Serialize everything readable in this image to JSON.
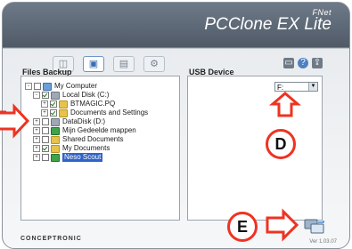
{
  "app": {
    "brand_top": "FNet",
    "brand_main": "PCClone EX Lite"
  },
  "tabs": [
    {
      "name": "tab-1",
      "icon": "drive-icon"
    },
    {
      "name": "tab-2",
      "icon": "monitor-icon"
    },
    {
      "name": "tab-3",
      "icon": "image-icon"
    },
    {
      "name": "tab-4",
      "icon": "settings-icon"
    }
  ],
  "utility": [
    {
      "icon": "screen-icon"
    },
    {
      "icon": "help-icon"
    },
    {
      "icon": "upload-icon"
    }
  ],
  "files_backup": {
    "label": "Files Backup",
    "tree": [
      {
        "level": 0,
        "exp": "-",
        "checked": false,
        "icon": "pc",
        "text": "My Computer"
      },
      {
        "level": 1,
        "exp": "-",
        "checked": true,
        "icon": "drive",
        "text": "Local Disk (C:)"
      },
      {
        "level": 2,
        "exp": "+",
        "checked": true,
        "icon": "folder",
        "text": "BTMAGIC.PQ"
      },
      {
        "level": 2,
        "exp": "+",
        "checked": true,
        "icon": "folder",
        "text": "Documents and Settings"
      },
      {
        "level": 1,
        "exp": "+",
        "checked": false,
        "icon": "drive",
        "text": "DataDisk (D:)"
      },
      {
        "level": 1,
        "exp": "+",
        "checked": false,
        "icon": "special",
        "text": "Mijn Gedeelde mappen"
      },
      {
        "level": 1,
        "exp": "+",
        "checked": false,
        "icon": "folder",
        "text": "Shared Documents"
      },
      {
        "level": 1,
        "exp": "+",
        "checked": true,
        "icon": "folder",
        "text": "My Documents"
      },
      {
        "level": 1,
        "exp": "+",
        "checked": false,
        "icon": "special",
        "text": "Neso Scout",
        "selected": true
      }
    ]
  },
  "usb_device": {
    "label": "USB Device",
    "selected": "F:"
  },
  "footer": {
    "brand": "CONCEPTRONIC",
    "version": "Ver 1.03.07"
  },
  "callouts": {
    "d_label": "D",
    "e_label": "E"
  },
  "colors": {
    "annotation": "#ee3322",
    "selection": "#2f64c8"
  }
}
